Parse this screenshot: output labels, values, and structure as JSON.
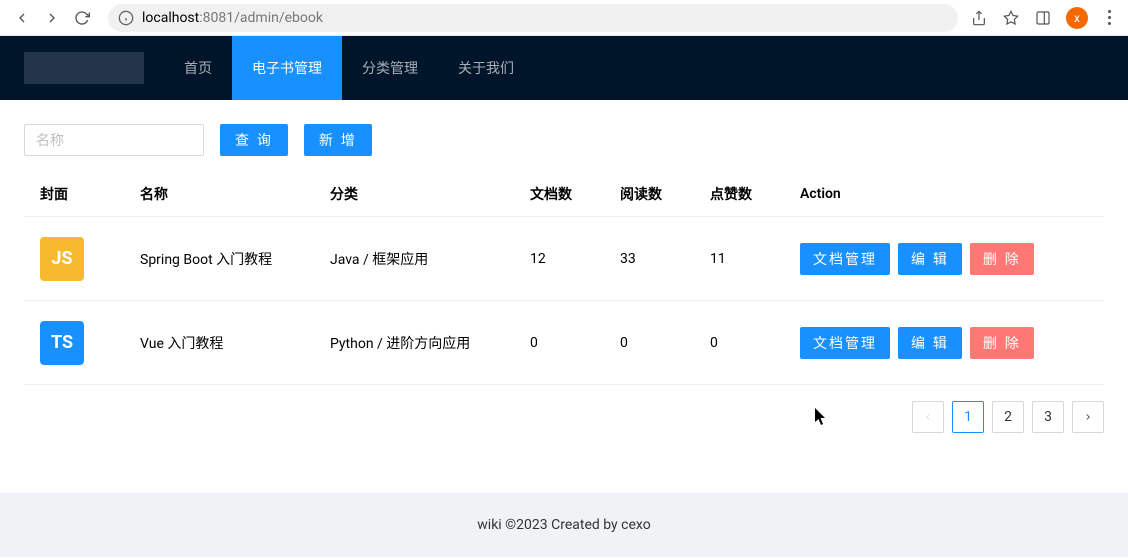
{
  "browser": {
    "url_host": "localhost",
    "url_port": ":8081",
    "url_path": "/admin/ebook",
    "avatar_letter": "x"
  },
  "nav": {
    "items": [
      {
        "label": "首页"
      },
      {
        "label": "电子书管理"
      },
      {
        "label": "分类管理"
      },
      {
        "label": "关于我们"
      }
    ]
  },
  "toolbar": {
    "search_placeholder": "名称",
    "query_label": "查 询",
    "add_label": "新 增"
  },
  "table": {
    "headers": {
      "cover": "封面",
      "name": "名称",
      "category": "分类",
      "docs": "文档数",
      "views": "阅读数",
      "likes": "点赞数",
      "action": "Action"
    },
    "actions": {
      "doc_manage": "文档管理",
      "edit": "编 辑",
      "delete": "删 除"
    },
    "rows": [
      {
        "cover_text": "JS",
        "cover_class": "cover-js",
        "name": "Spring Boot 入门教程",
        "category": "Java / 框架应用",
        "docs": "12",
        "views": "33",
        "likes": "11"
      },
      {
        "cover_text": "TS",
        "cover_class": "cover-ts",
        "name": "Vue 入门教程",
        "category": "Python / 进阶方向应用",
        "docs": "0",
        "views": "0",
        "likes": "0"
      }
    ]
  },
  "pagination": {
    "pages": [
      "1",
      "2",
      "3"
    ],
    "current": "1"
  },
  "footer": {
    "text": "wiki ©2023 Created by cexo"
  }
}
